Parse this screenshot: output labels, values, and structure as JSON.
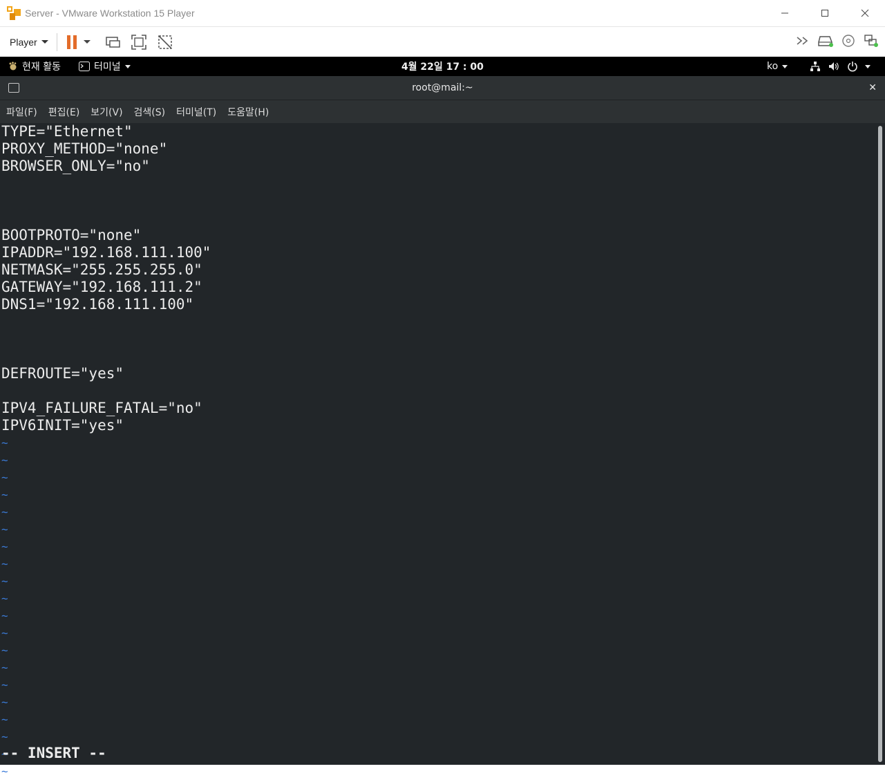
{
  "window": {
    "title": "Server - VMware Workstation 15 Player",
    "minimize": "—",
    "maximize": "☐",
    "close": "✕"
  },
  "toolbar": {
    "player_menu": "Player"
  },
  "gnome": {
    "activities": "현재 활동",
    "app_menu": "터미널",
    "clock": "4월 22일  17 : 00",
    "language": "ko"
  },
  "terminal": {
    "title": "root@mail:~",
    "close": "✕",
    "menu": [
      "파일(F)",
      "편집(E)",
      "보기(V)",
      "검색(S)",
      "터미널(T)",
      "도움말(H)"
    ],
    "lines": [
      "TYPE=\"Ethernet\"",
      "PROXY_METHOD=\"none\"",
      "BROWSER_ONLY=\"no\"",
      "",
      "",
      "",
      "BOOTPROTO=\"none\"",
      "IPADDR=\"192.168.111.100\"",
      "NETMASK=\"255.255.255.0\"",
      "GATEWAY=\"192.168.111.2\"",
      "DNS1=\"192.168.111.100\"",
      "",
      "",
      "",
      "DEFROUTE=\"yes\"",
      "",
      "IPV4_FAILURE_FATAL=\"no\"",
      "IPV6INIT=\"yes\"",
      "~",
      "~",
      "~",
      "~",
      "~",
      "~",
      "~",
      "~",
      "~",
      "~",
      "~",
      "~",
      "~",
      "~",
      "~",
      "~",
      "~",
      "~",
      "~",
      "~"
    ],
    "mode": "-- INSERT --"
  },
  "icons": {
    "vmware_logo": "vmware-logo-icon",
    "pause": "pause-icon",
    "ctrl_alt_del": "send-ctrl-alt-del-icon",
    "fullscreen": "fullscreen-icon",
    "unity": "unity-icon",
    "more": "more-devices-icon",
    "hdd": "hard-disk-icon",
    "cd": "cd-drive-icon",
    "network": "network-adapter-icon"
  },
  "colors": {
    "pause_orange": "#e36c2a",
    "terminal_bg": "#222629",
    "tilde_blue": "#3b7bd8"
  }
}
